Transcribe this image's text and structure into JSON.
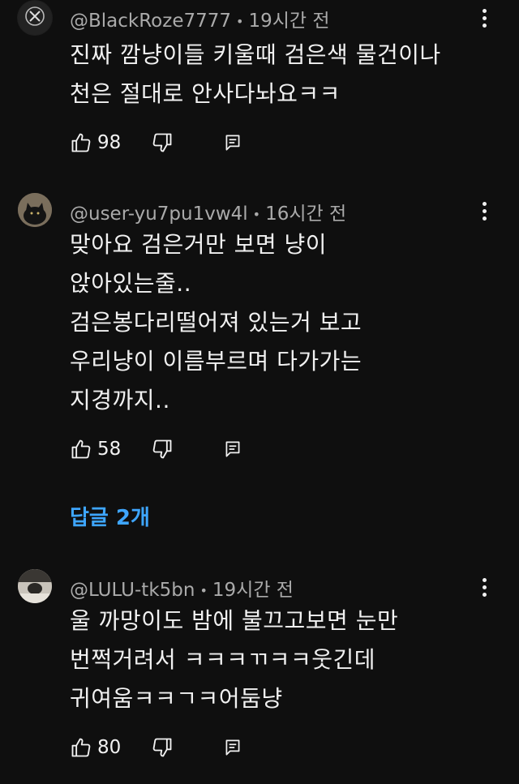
{
  "comments": [
    {
      "handle": "@BlackRoze7777",
      "time": "19시간 전",
      "text": "진짜 깜냥이들 키울때 검은색 물건이나\n천은 절대로 안사다놔요ㅋㅋ",
      "likes": "98"
    },
    {
      "handle": "@user-yu7pu1vw4l",
      "time": "16시간 전",
      "text": "맞아요 검은거만 보면 냥이\n앉아있는줄..\n검은봉다리떨어져 있는거 보고\n우리냥이 이름부르며 다가가는\n지경까지..",
      "likes": "58",
      "replies_label": "답글 2개"
    },
    {
      "handle": "@LULU-tk5bn",
      "time": "19시간 전",
      "text": "울 까망이도 밤에 불끄고보면 눈만\n번쩍거려서 ㅋㅋㅋㄲㅋㅋ웃긴데\n귀여움ㅋㅋㄱㅋ어둠냥",
      "likes": "80"
    }
  ],
  "separator": "•",
  "colors": {
    "background": "#0f0f0f",
    "text": "#f1f1f1",
    "meta": "#aaaaaa",
    "link": "#3ea6ff"
  },
  "icons": [
    "like-icon",
    "dislike-icon",
    "reply-icon",
    "more-vert-icon"
  ]
}
